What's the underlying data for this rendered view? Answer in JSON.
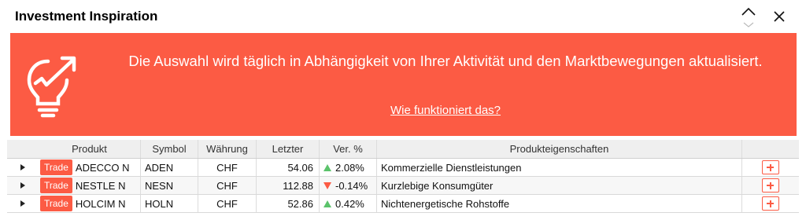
{
  "header": {
    "title": "Investment Inspiration"
  },
  "banner": {
    "message": "Die Auswahl wird täglich in Abhängigkeit von Ihrer Aktivität und den Marktbewegungen aktualisiert.",
    "link": "Wie funktioniert das?",
    "color": "#fc5b44"
  },
  "table": {
    "columns": {
      "product": "Produkt",
      "symbol": "Symbol",
      "currency": "Währung",
      "last": "Letzter",
      "change": "Ver. %",
      "properties": "Produkteigenschaften"
    },
    "trade_label": "Trade",
    "rows": [
      {
        "product": "ADECCO N",
        "symbol": "ADEN",
        "currency": "CHF",
        "last": "54.06",
        "change": "2.08%",
        "direction": "up",
        "properties": "Kommerzielle Dienstleistungen"
      },
      {
        "product": "NESTLE N",
        "symbol": "NESN",
        "currency": "CHF",
        "last": "112.88",
        "change": "-0.14%",
        "direction": "down",
        "properties": "Kurzlebige Konsumgüter"
      },
      {
        "product": "HOLCIM N",
        "symbol": "HOLN",
        "currency": "CHF",
        "last": "52.86",
        "change": "0.42%",
        "direction": "up",
        "properties": "Nichtenergetische Rohstoffe"
      }
    ]
  },
  "icons": {
    "collapse": "chevron-up-icon",
    "close": "close-icon",
    "banner": "lightbulb-growth-icon"
  }
}
